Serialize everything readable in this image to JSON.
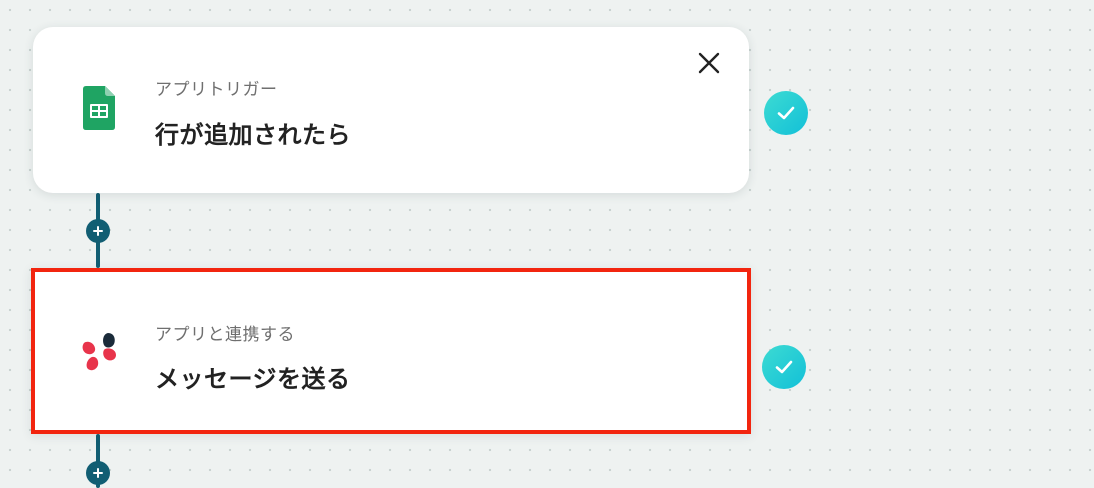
{
  "flow": {
    "steps": [
      {
        "category": "アプリトリガー",
        "title": "行が追加されたら",
        "app_icon": "google-sheets-icon",
        "status": "completed",
        "selected": false
      },
      {
        "category": "アプリと連携する",
        "title": "メッセージを送る",
        "app_icon": "chatwork-icon",
        "status": "completed",
        "selected": true
      }
    ]
  },
  "colors": {
    "connector": "#115e73",
    "selected_border": "#f2250f",
    "check_badge": "#22cdd6",
    "sheets_green": "#1fa463",
    "chatwork_red": "#e8344b",
    "chatwork_navy": "#1b2b3a"
  },
  "icons": {
    "close": "close-icon",
    "check": "check-icon",
    "add": "plus-icon"
  }
}
